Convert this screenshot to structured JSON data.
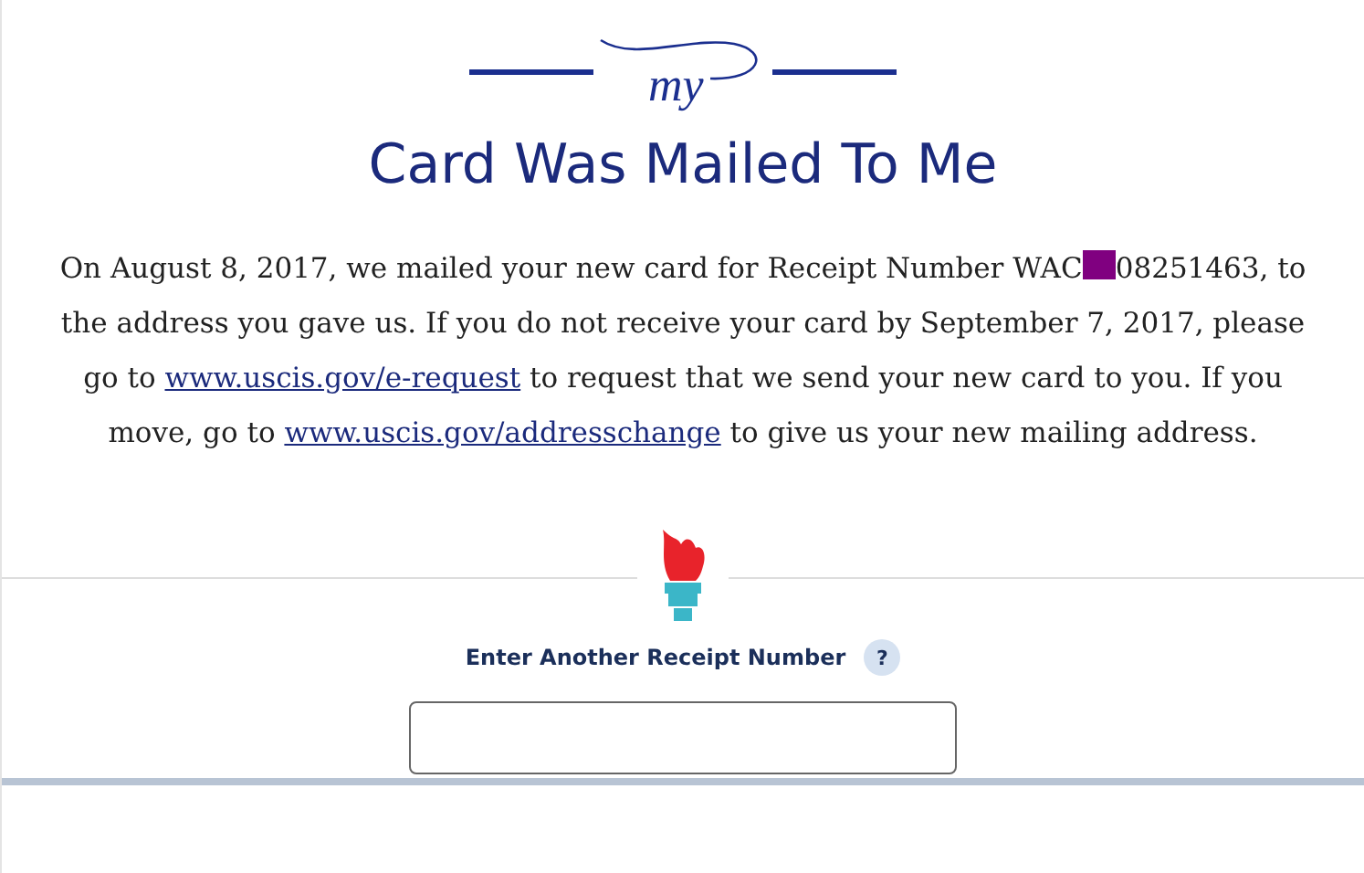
{
  "logo": {
    "text": "my"
  },
  "title": "Card Was Mailed To Me",
  "message": [
    {
      "kind": "text",
      "text": "On August 8, 2017, we mailed your new card for Receipt Number WAC"
    },
    {
      "kind": "redaction"
    },
    {
      "kind": "text",
      "text": "08251463, to the address you gave us. If you do not receive your card by September 7, 2017, please go to "
    },
    {
      "kind": "link",
      "text": "www.uscis.gov/e-request"
    },
    {
      "kind": "text",
      "text": " to request that we send your new card to you. If you move, go to "
    },
    {
      "kind": "link",
      "text": "www.uscis.gov/addresschange"
    },
    {
      "kind": "text",
      "text": " to give us your new mailing address."
    }
  ],
  "receipt_form": {
    "label": "Enter Another Receipt Number",
    "help": "?"
  }
}
